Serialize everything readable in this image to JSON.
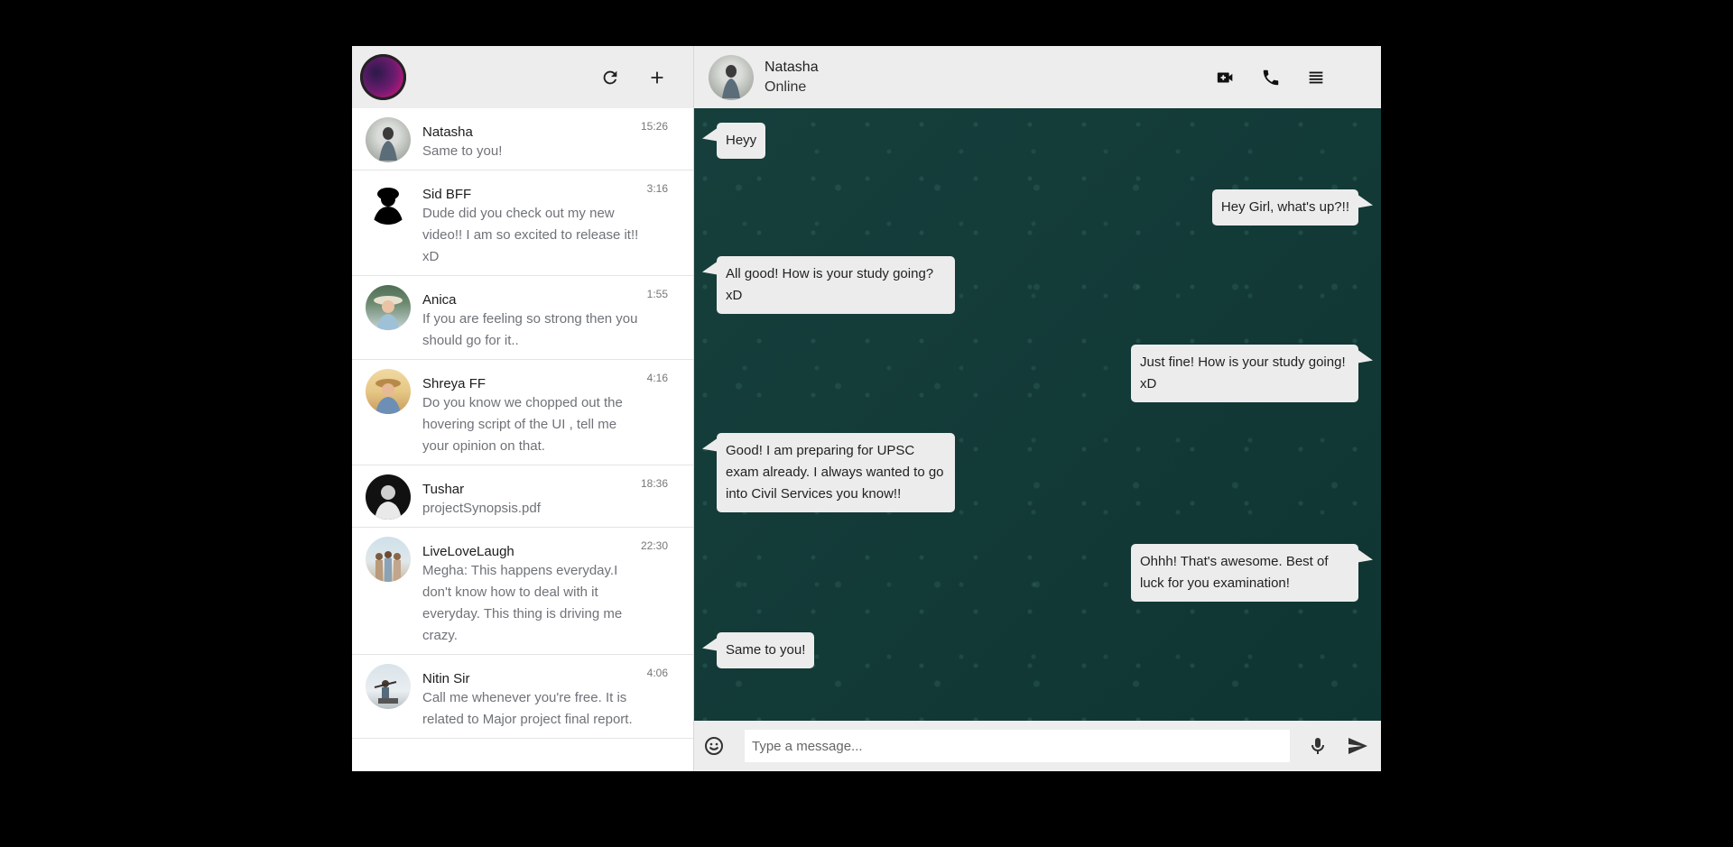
{
  "sidebar": {
    "icons": {
      "refresh": "refresh-icon",
      "new_chat": "plus-icon"
    },
    "chats": [
      {
        "name": "Natasha",
        "message": "Same to you!",
        "time": "15:26"
      },
      {
        "name": "Sid BFF",
        "message": "Dude did you check out my new video!! I am so excited to release it!! xD",
        "time": "3:16"
      },
      {
        "name": "Anica",
        "message": "If you are feeling so strong then you should go for it..",
        "time": "1:55"
      },
      {
        "name": "Shreya FF",
        "message": "Do you know we chopped out the hovering script of the UI , tell me your opinion on that.",
        "time": "4:16"
      },
      {
        "name": "Tushar",
        "message": "projectSynopsis.pdf",
        "time": "18:36"
      },
      {
        "name": "LiveLoveLaugh",
        "message": "Megha: This happens everyday.I don't know how to deal with it everyday. This thing is driving me crazy.",
        "time": "22:30"
      },
      {
        "name": "Nitin Sir",
        "message": "Call me whenever you're free. It is related to Major project final report.",
        "time": "4:06"
      }
    ]
  },
  "header": {
    "contact_name": "Natasha",
    "contact_status": "Online",
    "icons": [
      "video-call-icon",
      "phone-icon",
      "menu-icon"
    ]
  },
  "messages": [
    {
      "direction": "in",
      "text": "Heyy"
    },
    {
      "direction": "out",
      "text": "Hey Girl, what's up?!!"
    },
    {
      "direction": "in",
      "text": "All good! How is your study going? xD"
    },
    {
      "direction": "out",
      "text": "Just fine! How is your study going! xD"
    },
    {
      "direction": "in",
      "text": "Good! I am preparing for UPSC exam already. I always wanted to go into Civil Services you know!!"
    },
    {
      "direction": "out",
      "text": "Ohhh! That's awesome. Best of luck for you examination!"
    },
    {
      "direction": "in",
      "text": "Same to you!"
    }
  ],
  "composer": {
    "placeholder": "Type a message...",
    "icons": [
      "emoji-icon",
      "mic-icon",
      "send-icon"
    ]
  },
  "colors": {
    "page_bg": "#000000",
    "header_bg": "#ededed",
    "chat_bg": "#123a38",
    "bubble_bg": "#ececec"
  }
}
